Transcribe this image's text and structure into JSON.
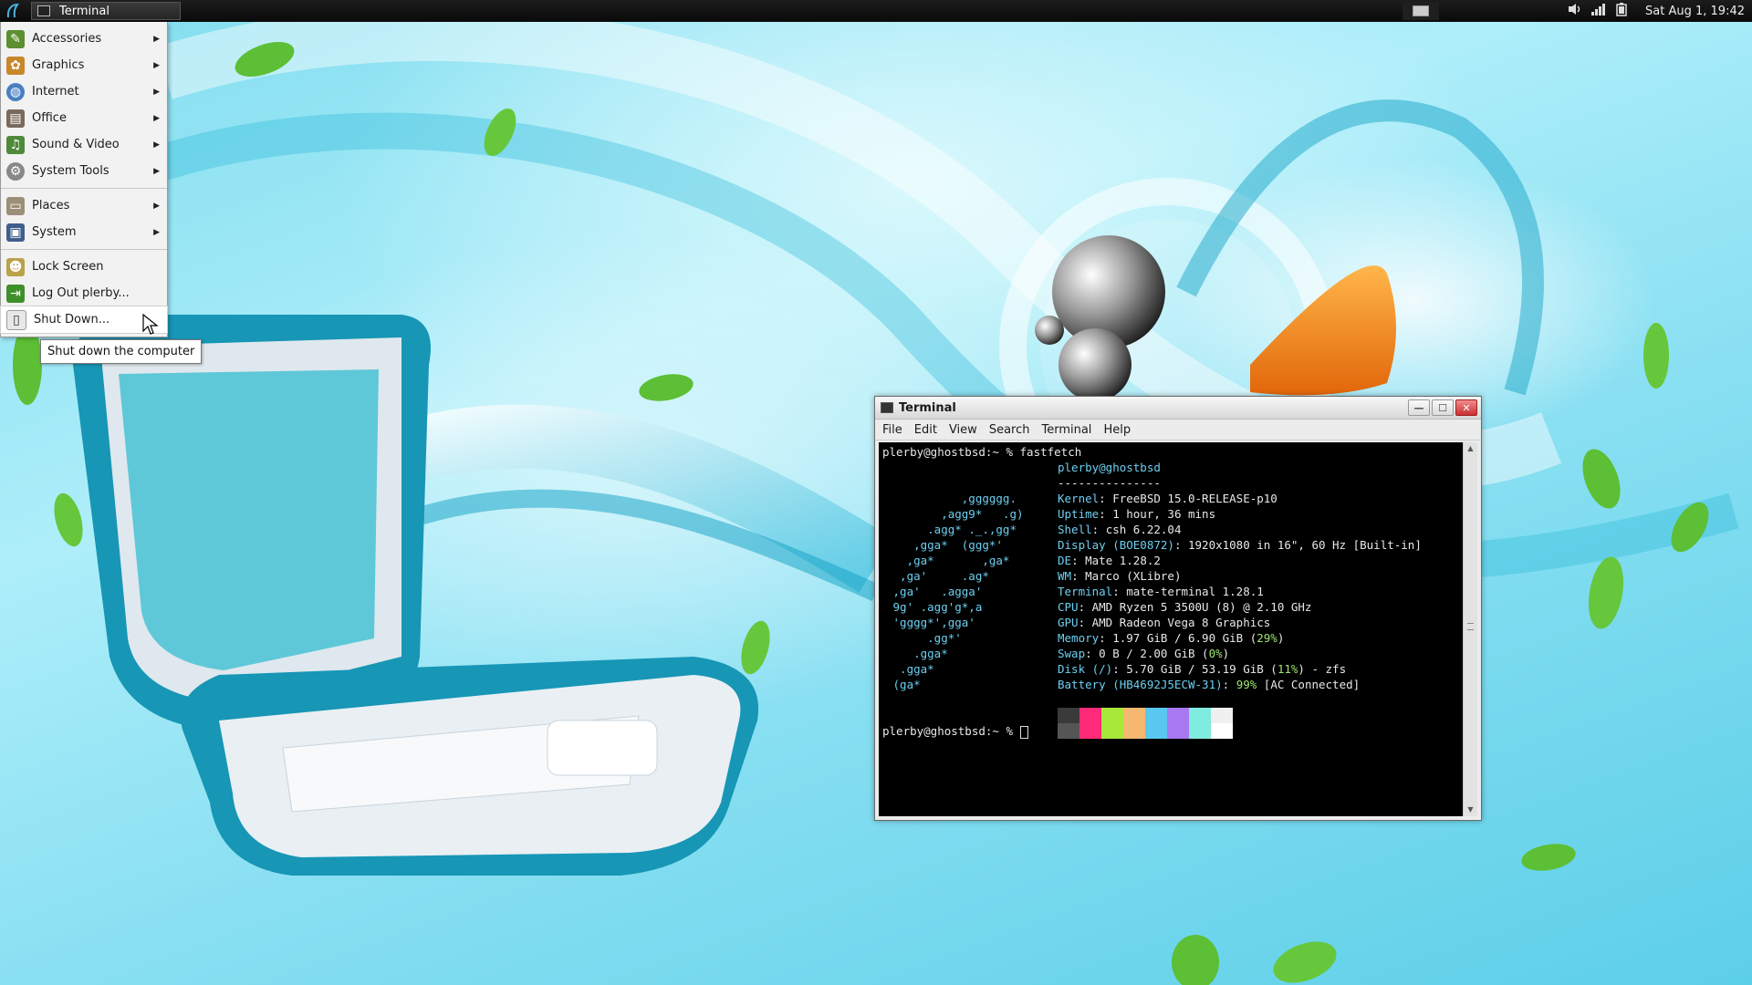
{
  "panel": {
    "task_label": "Terminal",
    "clock": "Sat Aug  1, 19:42"
  },
  "menu": {
    "items": [
      {
        "label": "Accessories",
        "icon": "accessories-icon",
        "color": "#5b8f2f"
      },
      {
        "label": "Graphics",
        "icon": "graphics-icon",
        "color": "#c7872b"
      },
      {
        "label": "Internet",
        "icon": "internet-icon",
        "color": "#4a7fc2"
      },
      {
        "label": "Office",
        "icon": "office-icon",
        "color": "#7a6a5a"
      },
      {
        "label": "Sound & Video",
        "icon": "sound-video-icon",
        "color": "#4f8a3a"
      },
      {
        "label": "System Tools",
        "icon": "system-tools-icon",
        "color": "#888888"
      }
    ],
    "places": {
      "label": "Places"
    },
    "system": {
      "label": "System"
    },
    "lock": {
      "label": "Lock Screen"
    },
    "logout": {
      "label": "Log Out plerby..."
    },
    "shutdown": {
      "label": "Shut Down..."
    }
  },
  "tooltip": "Shut down the computer",
  "terminal": {
    "title": "Terminal",
    "menus": [
      "File",
      "Edit",
      "View",
      "Search",
      "Terminal",
      "Help"
    ],
    "prompt1": "plerby@ghostbsd:~ % fastfetch",
    "prompt2": "plerby@ghostbsd:~ % ",
    "logo": [
      "           ,gggggg.",
      "        ,agg9*   .g)",
      "      .agg* ._.,gg*",
      "    ,gga*  (ggg*'",
      "   ,ga*       ,ga*",
      "  ,ga'     .ag*",
      " ,ga'   .agga'",
      " 9g' .agg'g*,a",
      " 'gggg*',gga'",
      "      .gg*'",
      "    .gga*",
      "  .gga*",
      " (ga*"
    ],
    "user_host": "plerby@ghostbsd",
    "rule": "---------------",
    "info": [
      {
        "key": "Kernel",
        "value": ": FreeBSD 15.0-RELEASE-p10",
        "pct": "",
        "tail": ""
      },
      {
        "key": "Uptime",
        "value": ": 1 hour, 36 mins",
        "pct": "",
        "tail": ""
      },
      {
        "key": "Shell",
        "value": ": csh 6.22.04",
        "pct": "",
        "tail": ""
      },
      {
        "key": "Display (BOE0872)",
        "value": ": 1920x1080 in 16\", 60 Hz [Built-in]",
        "pct": "",
        "tail": ""
      },
      {
        "key": "DE",
        "value": ": Mate 1.28.2",
        "pct": "",
        "tail": ""
      },
      {
        "key": "WM",
        "value": ": Marco (XLibre)",
        "pct": "",
        "tail": ""
      },
      {
        "key": "Terminal",
        "value": ": mate-terminal 1.28.1",
        "pct": "",
        "tail": ""
      },
      {
        "key": "CPU",
        "value": ": AMD Ryzen 5 3500U (8) @ 2.10 GHz",
        "pct": "",
        "tail": ""
      },
      {
        "key": "GPU",
        "value": ": AMD Radeon Vega 8 Graphics",
        "pct": "",
        "tail": ""
      },
      {
        "key": "Memory",
        "value": ": 1.97 GiB / 6.90 GiB (",
        "pct": "29%",
        "tail": ")"
      },
      {
        "key": "Swap",
        "value": ": 0 B / 2.00 GiB (",
        "pct": "0%",
        "tail": ")"
      },
      {
        "key": "Disk (/)",
        "value": ": 5.70 GiB / 53.19 GiB (",
        "pct": "11%",
        "tail": ") - zfs"
      },
      {
        "key": "Battery (HB4692J5ECW-31)",
        "value": ": ",
        "pct": "99%",
        "tail": " [AC Connected]"
      }
    ],
    "palette": [
      "#3a3a3a",
      "#ff2a78",
      "#a8e83a",
      "#f5b870",
      "#58c8f0",
      "#a878f0",
      "#80ece0",
      "#f0f0f0",
      "#555555",
      "#ff2a78",
      "#a8e83a",
      "#f5b870",
      "#58c8f0",
      "#a878f0",
      "#80ece0",
      "#ffffff"
    ]
  }
}
